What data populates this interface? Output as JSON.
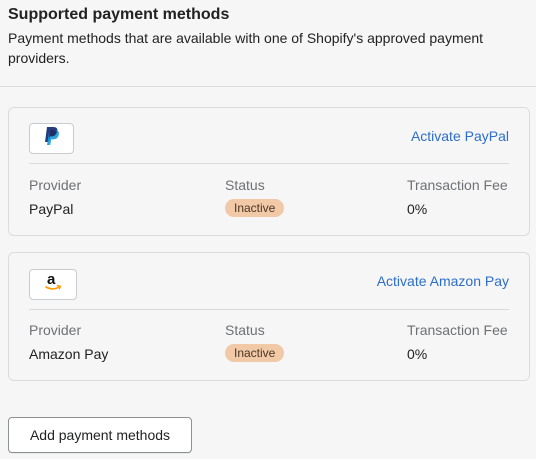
{
  "section": {
    "title": "Supported payment methods",
    "description": "Payment methods that are available with one of Shopify's approved payment providers."
  },
  "columns": {
    "provider": "Provider",
    "status": "Status",
    "fee": "Transaction Fee"
  },
  "providers": [
    {
      "name": "PayPal",
      "logo_icon": "paypal-logo-icon",
      "activate_label": "Activate PayPal",
      "status": "Inactive",
      "fee": "0%"
    },
    {
      "name": "Amazon Pay",
      "logo_icon": "amazon-logo-icon",
      "activate_label": "Activate Amazon Pay",
      "status": "Inactive",
      "fee": "0%"
    }
  ],
  "add_button_label": "Add payment methods",
  "colors": {
    "link": "#2c6ecb",
    "badge_inactive": "#f1c9a7",
    "paypal_dark": "#253b80",
    "paypal_light": "#179bd7",
    "amazon_orange": "#ff9900"
  }
}
